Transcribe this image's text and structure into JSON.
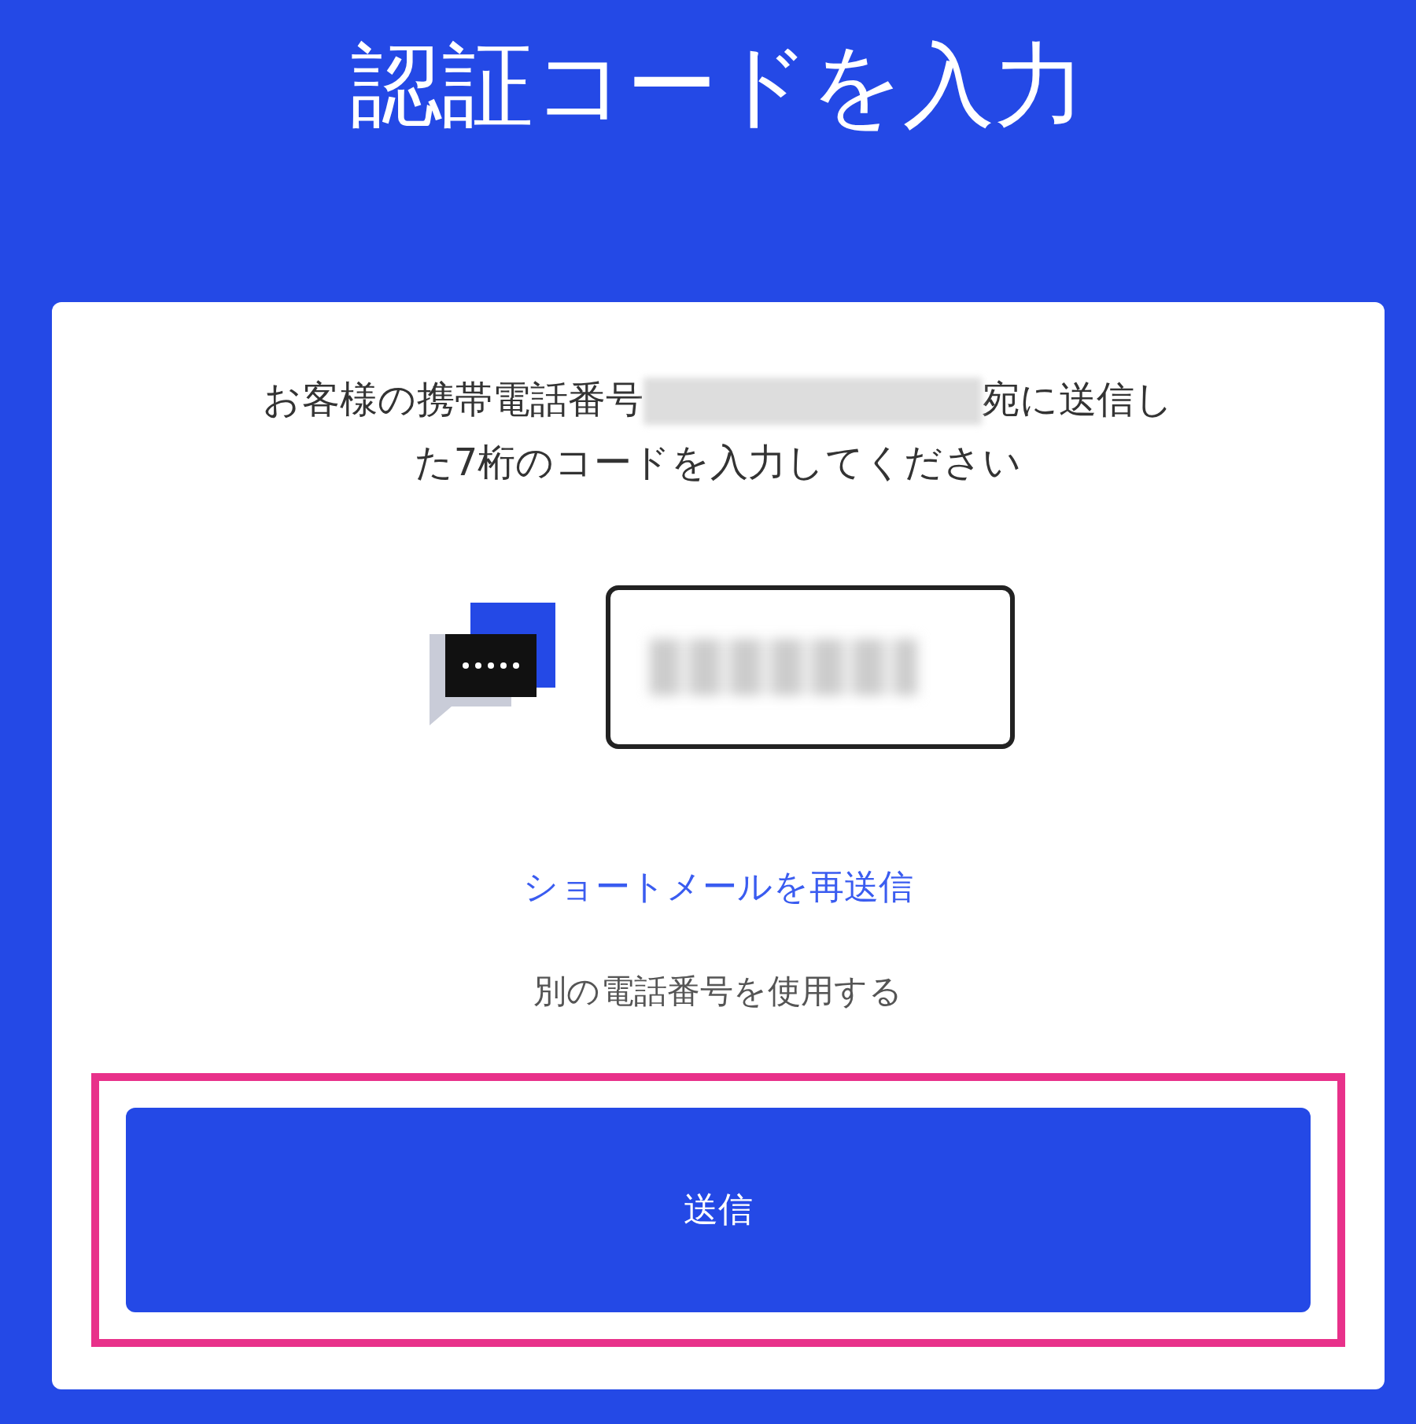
{
  "title": "認証コードを入力",
  "message": {
    "before": "お客様の携帯電話番号",
    "after": "宛に送信し",
    "second_line": "た7桁のコードを入力してください"
  },
  "resend_link": "ショートメールを再送信",
  "other_number": "別の電話番号を使用する",
  "submit_button": {
    "label": "送信",
    "highlighted": true
  }
}
